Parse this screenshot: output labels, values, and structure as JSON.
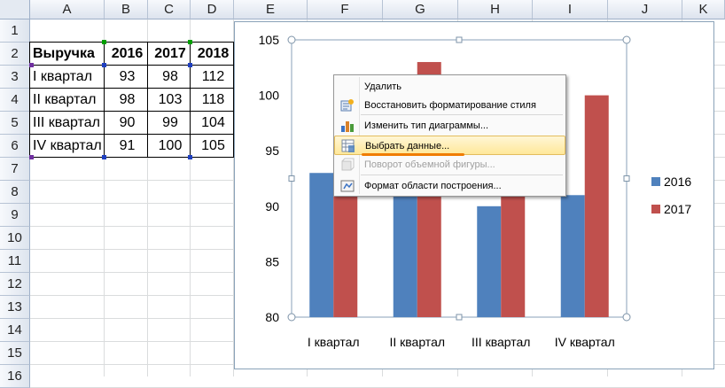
{
  "columns": [
    "A",
    "B",
    "C",
    "D",
    "E",
    "F",
    "G",
    "H",
    "I",
    "J",
    "K"
  ],
  "rows": [
    "1",
    "2",
    "3",
    "4",
    "5",
    "6",
    "7",
    "8",
    "9",
    "10",
    "11",
    "12",
    "13",
    "14",
    "15",
    "16"
  ],
  "table": {
    "header": [
      "Выручка",
      "2016",
      "2017",
      "2018"
    ],
    "rows": [
      [
        "I квартал",
        "93",
        "98",
        "112"
      ],
      [
        "II квартал",
        "98",
        "103",
        "118"
      ],
      [
        "III квартал",
        "90",
        "99",
        "104"
      ],
      [
        "IV квартал",
        "91",
        "100",
        "105"
      ]
    ]
  },
  "context_menu": {
    "items": [
      {
        "label": "Удалить",
        "icon": "none",
        "enabled": true
      },
      {
        "label": "Восстановить форматирование стиля",
        "icon": "reset-style-icon",
        "enabled": true
      },
      {
        "label": "Изменить тип диаграммы...",
        "icon": "chart-type-icon",
        "enabled": true
      },
      {
        "label": "Выбрать данные...",
        "icon": "select-data-icon",
        "enabled": true,
        "highlighted": true
      },
      {
        "label": "Поворот объемной фигуры...",
        "icon": "rotate-3d-icon",
        "enabled": false
      },
      {
        "label": "Формат области построения...",
        "icon": "format-area-icon",
        "enabled": true
      }
    ]
  },
  "colors": {
    "series_2016": "#4f81bd",
    "series_2017": "#c0504d",
    "highlight_underline": "#f07c00"
  },
  "chart_data": {
    "type": "bar",
    "categories": [
      "I квартал",
      "II квартал",
      "III квартал",
      "IV квартал"
    ],
    "series": [
      {
        "name": "2016",
        "values": [
          93,
          98,
          90,
          91
        ]
      },
      {
        "name": "2017",
        "values": [
          98,
          103,
          99,
          100
        ]
      }
    ],
    "yticks": [
      "80",
      "85",
      "90",
      "95",
      "100",
      "105"
    ],
    "ylim": [
      80,
      105
    ],
    "grid": false,
    "legend": "right"
  }
}
